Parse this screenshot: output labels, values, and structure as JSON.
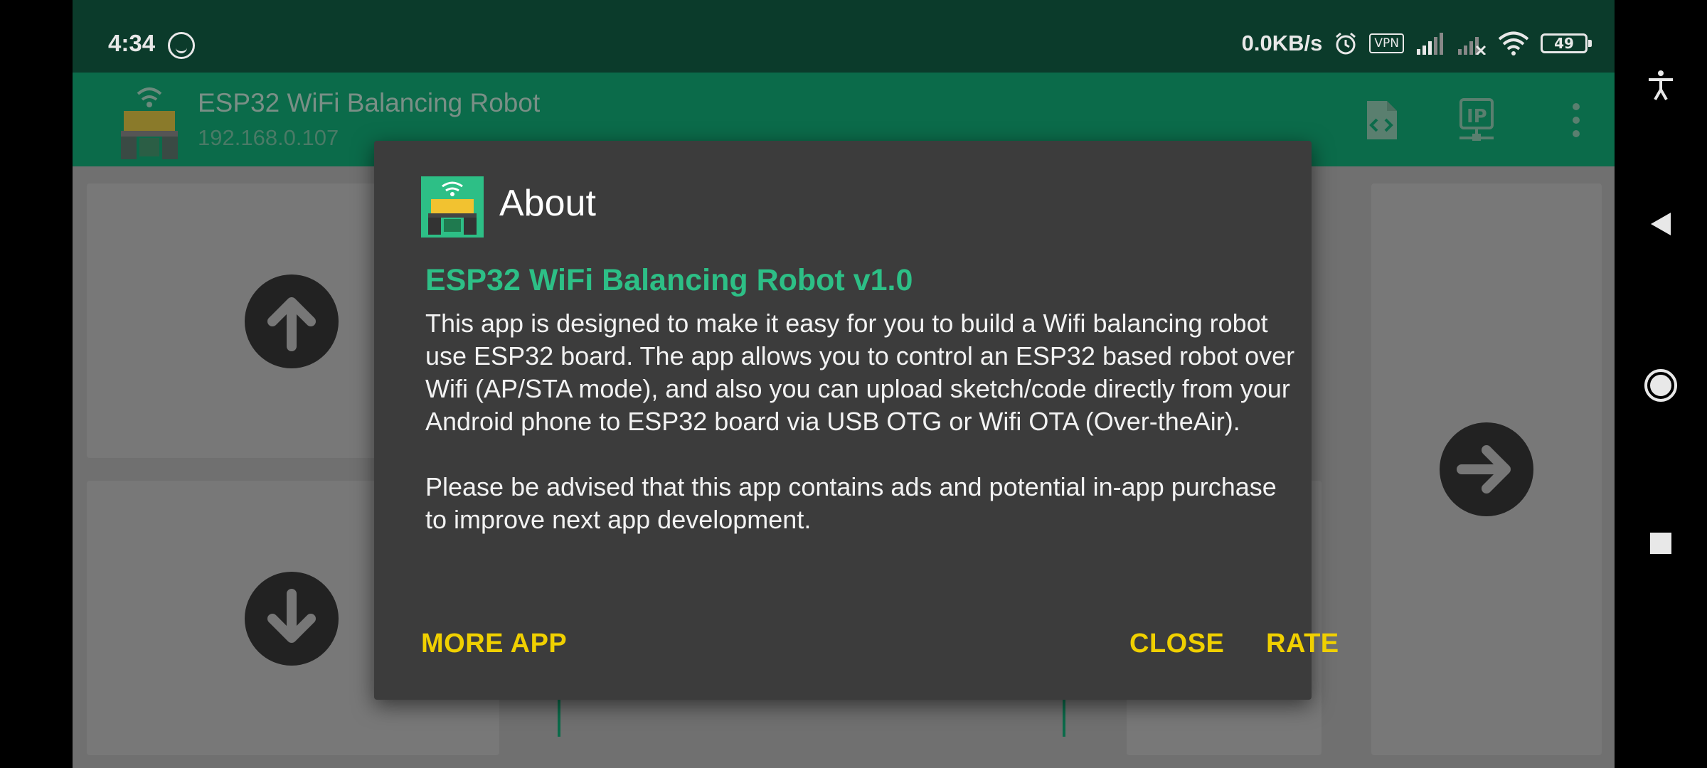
{
  "status_bar": {
    "time": "4:34",
    "net_speed": "0.0KB/s",
    "vpn_label": "VPN",
    "battery_level": "49"
  },
  "app_bar": {
    "title": "ESP32 WiFi Balancing Robot",
    "subtitle": "192.168.0.107",
    "actions": [
      "code-file-icon",
      "ip-network-icon",
      "more-vert-icon"
    ]
  },
  "controls": {
    "up": "arrow-up-icon",
    "down": "arrow-down-icon",
    "right": "arrow-right-icon"
  },
  "dialog": {
    "title": "About",
    "heading": "ESP32 WiFi Balancing Robot v1.0",
    "paragraph1": "This app is designed to make it easy for you to build a Wifi balancing robot use ESP32 board. The app allows you to control an ESP32 based robot over Wifi (AP/STA mode), and also you can upload sketch/code directly from your Android phone to ESP32 board via USB OTG or Wifi OTA (Over-theAir).",
    "paragraph2": "Please be advised that this app contains ads and potential in-app purchase to improve next app development.",
    "buttons": {
      "more_app": "MORE APP",
      "close": "CLOSE",
      "rate": "RATE"
    }
  },
  "colors": {
    "status_bg": "#0b3b2b",
    "appbar_bg": "#0b6b4a",
    "accent_green": "#2dbf86",
    "dialog_bg": "#3c3c3c",
    "button_yellow": "#f0d000"
  }
}
